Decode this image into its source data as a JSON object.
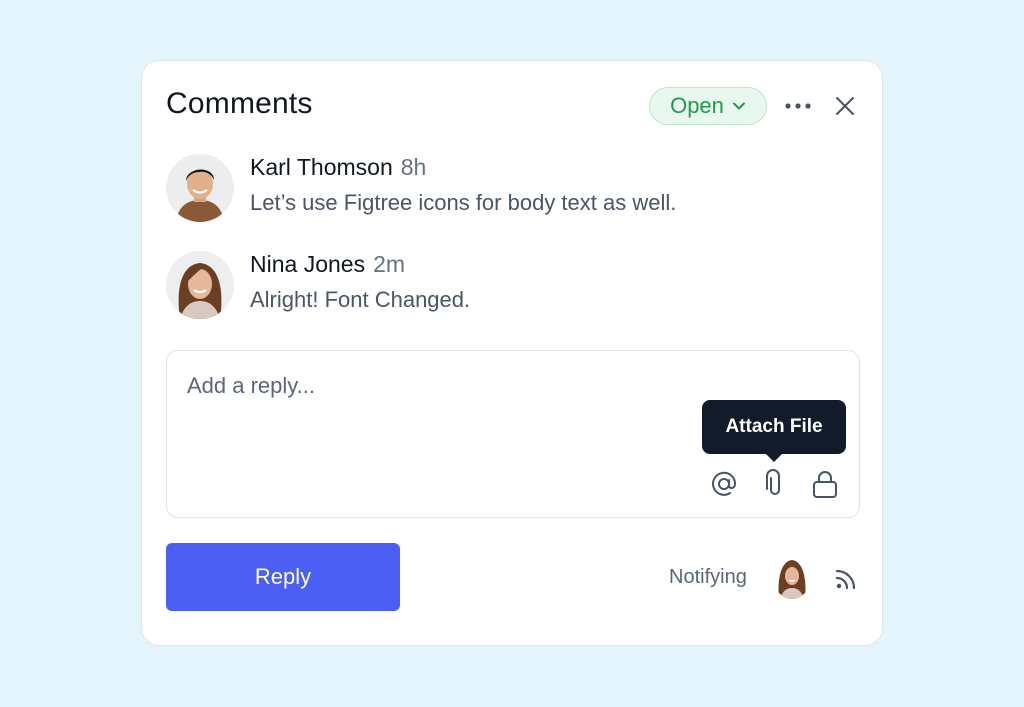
{
  "panel": {
    "title": "Comments",
    "status": "Open"
  },
  "comments": [
    {
      "author": "Karl Thomson",
      "time": "8h",
      "text": "Let’s use Figtree icons for body text as well."
    },
    {
      "author": "Nina Jones",
      "time": "2m",
      "text": "Alright! Font Changed."
    }
  ],
  "reply": {
    "placeholder": "Add a reply...",
    "value": "",
    "tooltip": "Attach File",
    "tools": [
      "at-mention-icon",
      "paperclip-icon",
      "lock-icon"
    ]
  },
  "footer": {
    "reply_label": "Reply",
    "notifying_label": "Notifying"
  },
  "colors": {
    "background": "#e3f4fc",
    "accent": "#4b5ff5",
    "status_green": "#1f9a4c",
    "tooltip_bg": "#111b29"
  }
}
